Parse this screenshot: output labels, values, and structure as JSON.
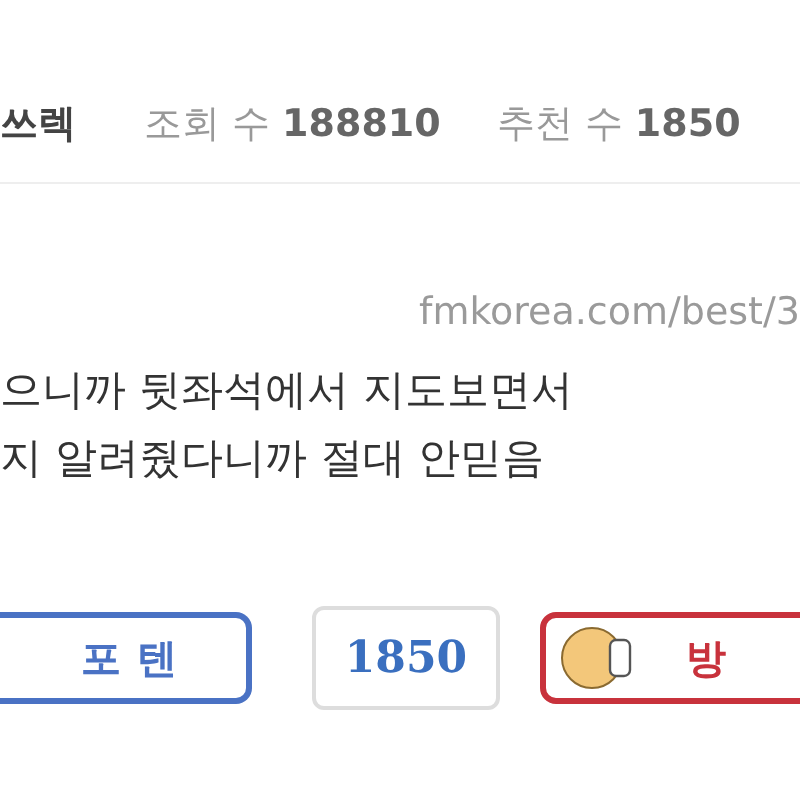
{
  "header": {
    "author": "쓰렉",
    "views_label": "조회 수",
    "views": "188810",
    "votes_label": "추천 수",
    "votes": "1850"
  },
  "source_url": "fmkorea.com/best/3",
  "body": [
    "으니까 뒷좌석에서 지도보면서",
    "지 알려줬다니까 절대 안믿음"
  ],
  "actions": [
    {
      "kind": "upvote",
      "label": "포텐"
    },
    {
      "kind": "count",
      "label": "1850"
    },
    {
      "kind": "downvote",
      "label": "방"
    }
  ]
}
